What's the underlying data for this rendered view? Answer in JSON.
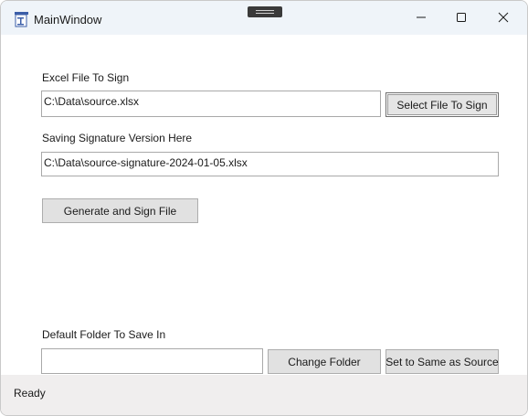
{
  "window": {
    "title": "MainWindow",
    "icon": "app-document-icon"
  },
  "caption_buttons": {
    "minimize": "minimize-icon",
    "maximize": "maximize-icon",
    "close": "close-icon"
  },
  "excel_file": {
    "label": "Excel File To Sign",
    "value": "C:\\Data\\source.xlsx",
    "button_label": "Select File To Sign"
  },
  "signature_file": {
    "label": "Saving Signature Version Here",
    "value": "C:\\Data\\source-signature-2024-01-05.xlsx"
  },
  "generate": {
    "button_label": "Generate and Sign File"
  },
  "default_folder": {
    "label": "Default Folder To Save In",
    "value": "",
    "change_label": "Change Folder",
    "same_label": "Set to Same as Source"
  },
  "status": {
    "text": "Ready"
  }
}
